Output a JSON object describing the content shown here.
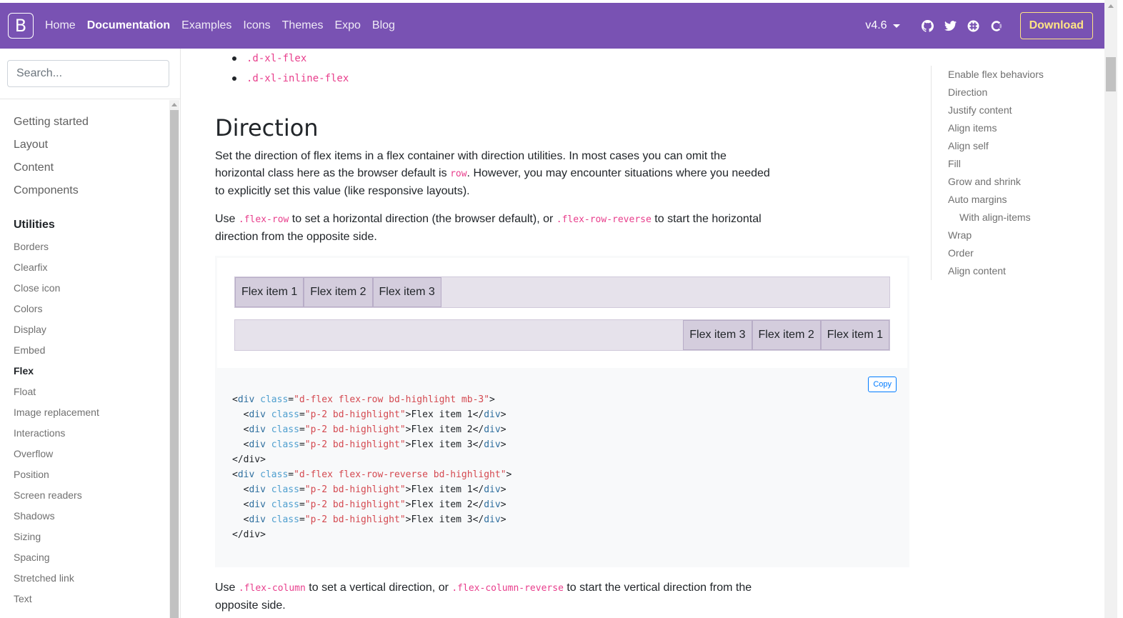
{
  "navbar": {
    "brand": "B",
    "links": [
      "Home",
      "Documentation",
      "Examples",
      "Icons",
      "Themes",
      "Expo",
      "Blog"
    ],
    "active_link": "Documentation",
    "version": "v4.6",
    "social_icons": [
      "github-icon",
      "twitter-icon",
      "slack-icon",
      "opencollective-icon"
    ],
    "download_label": "Download",
    "colors": {
      "background": "#7952b3",
      "download": "#ffe484"
    }
  },
  "sidebar": {
    "search_placeholder": "Search...",
    "groups": [
      "Getting started",
      "Layout",
      "Content",
      "Components"
    ],
    "active_group": "Utilities",
    "items": [
      "Borders",
      "Clearfix",
      "Close icon",
      "Colors",
      "Display",
      "Embed",
      "Flex",
      "Float",
      "Image replacement",
      "Interactions",
      "Overflow",
      "Position",
      "Screen readers",
      "Shadows",
      "Sizing",
      "Spacing",
      "Stretched link",
      "Text"
    ],
    "active_item": "Flex"
  },
  "main": {
    "bullets": [
      ".d-xl-flex",
      ".d-xl-inline-flex"
    ],
    "heading": "Direction",
    "para1": {
      "t1": "Set the direction of flex items in a flex container with direction utilities. In most cases you can omit the horizontal class here as the browser default is ",
      "code": "row",
      "t2": ". However, you may encounter situations where you needed to explicitly set this value (like responsive layouts)."
    },
    "para2": {
      "t1": "Use ",
      "code1": ".flex-row",
      "t2": " to set a horizontal direction (the browser default), or ",
      "code2": ".flex-row-reverse",
      "t3": " to start the horizontal direction from the opposite side."
    },
    "example": {
      "row": [
        "Flex item 1",
        "Flex item 2",
        "Flex item 3"
      ],
      "row_reverse": [
        "Flex item 3",
        "Flex item 2",
        "Flex item 1"
      ]
    },
    "copy_label": "Copy",
    "code": {
      "tag_open": "<",
      "tag_close": ">",
      "div": "div",
      "class_attr": "class",
      "line1_val": "\"d-flex flex-row bd-highlight mb-3\"",
      "item_val": "\"p-2 bd-highlight\"",
      "item1": "Flex item 1",
      "item2": "Flex item 2",
      "item3": "Flex item 3",
      "line5": "</div>",
      "line6_val": "\"d-flex flex-row-reverse bd-highlight\""
    },
    "para3": {
      "t1": "Use ",
      "code1": ".flex-column",
      "t2": " to set a vertical direction, or ",
      "code2": ".flex-column-reverse",
      "t3": " to start the vertical direction from the opposite side."
    }
  },
  "toc": [
    "Enable flex behaviors",
    "Direction",
    "Justify content",
    "Align items",
    "Align self",
    "Fill",
    "Grow and shrink",
    "Auto margins",
    "With align-items",
    "Wrap",
    "Order",
    "Align content"
  ]
}
